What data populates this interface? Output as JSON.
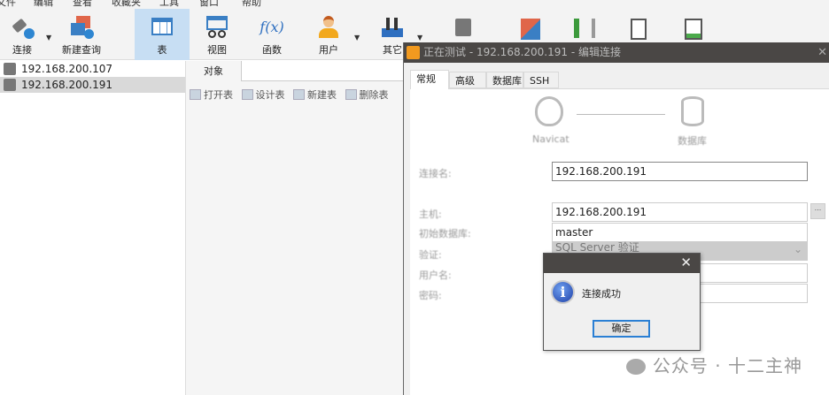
{
  "menu": [
    "文件",
    "编辑",
    "查看",
    "收藏夹",
    "工具",
    "窗口",
    "帮助"
  ],
  "toolbar": [
    {
      "label": "连接",
      "icon": "plug-icon"
    },
    {
      "label": "新建查询",
      "icon": "new-query-icon"
    },
    {
      "label": "表",
      "icon": "table-icon"
    },
    {
      "label": "视图",
      "icon": "view-icon"
    },
    {
      "label": "函数",
      "icon": "function-icon",
      "glyph": "f(x)"
    },
    {
      "label": "用户",
      "icon": "user-icon"
    },
    {
      "label": "其它",
      "icon": "tools-icon"
    }
  ],
  "connections": [
    "192.168.200.107",
    "192.168.200.191"
  ],
  "objects": {
    "tab": "对象",
    "tools": [
      "打开表",
      "设计表",
      "新建表",
      "删除表"
    ]
  },
  "dialog": {
    "title": "正在测试 - 192.168.200.191 - 编辑连接",
    "tabs": [
      "常规",
      "高级",
      "数据库",
      "SSH"
    ],
    "diagram": {
      "left": "Navicat",
      "right": "数据库"
    },
    "fields": {
      "conn_name_label": "连接名:",
      "conn_name": "192.168.200.191",
      "host_label": "主机:",
      "host": "192.168.200.191",
      "browse": "...",
      "initdb_label": "初始数据库:",
      "initdb": "master",
      "auth_label": "验证:",
      "auth": "SQL Server 验证",
      "user_label": "用户名:",
      "pwd_label": "密码:"
    }
  },
  "message": {
    "text": "连接成功",
    "ok": "确定",
    "close": "✕"
  },
  "watermark": "公众号 · 十二主神",
  "colors": {
    "titlebar": "#4a4745",
    "active_tool": "#c7def3",
    "accent": "#2a7fd4"
  }
}
